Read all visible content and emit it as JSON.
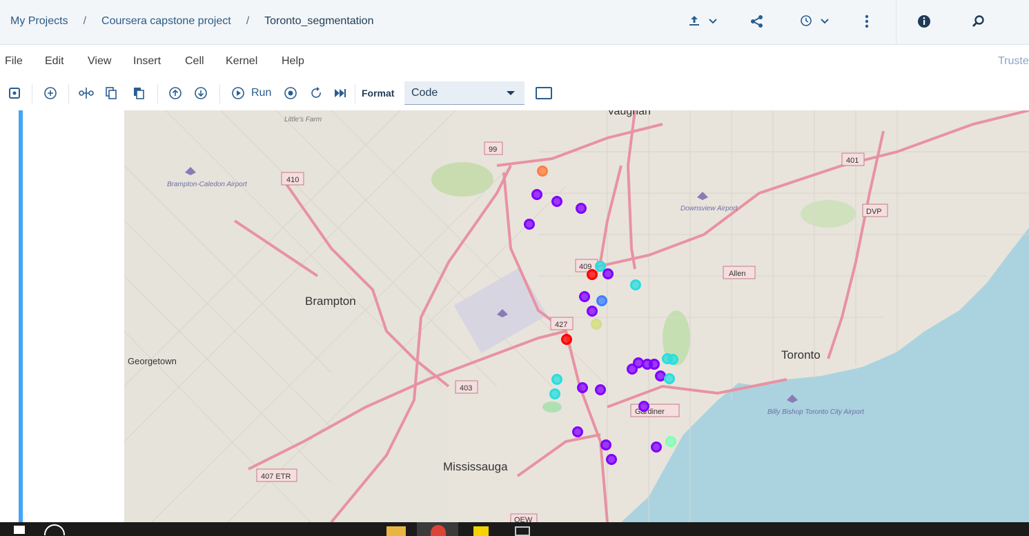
{
  "breadcrumb": {
    "items": [
      "My Projects",
      "Coursera capstone project",
      "Toronto_segmentation"
    ],
    "separator": "/"
  },
  "header_icons": [
    "upload-icon",
    "share-icon",
    "history-icon",
    "more-vert-icon",
    "info-icon",
    "find-icon"
  ],
  "menu": {
    "items": [
      "File",
      "Edit",
      "View",
      "Insert",
      "Cell",
      "Kernel",
      "Help"
    ],
    "trusted_label": "Truste"
  },
  "toolbar": {
    "run_label": "Run",
    "format_label": "Format",
    "format_value": "Code"
  },
  "map": {
    "place_labels": [
      "Vaughan",
      "Brampton",
      "Georgetown",
      "Toronto",
      "Mississauga",
      "Little's Farm",
      "Brampton-Caledon Airport",
      "Downsview Airport",
      "Billy Bishop Toronto City Airport"
    ],
    "shields": [
      "410",
      "99",
      "409",
      "427",
      "403",
      "407 ETR",
      "401",
      "DVP",
      "Allen",
      "Gardiner",
      "QEW"
    ],
    "colors": {
      "purple": "#8000ff",
      "cyan": "#2adddd",
      "red": "#ff0000",
      "orange": "#ff7f3f",
      "blue": "#3f7fff",
      "olive": "#d4dd80",
      "mint": "#80ffb4",
      "water": "#aad3df",
      "highway": "#e892a2"
    }
  }
}
